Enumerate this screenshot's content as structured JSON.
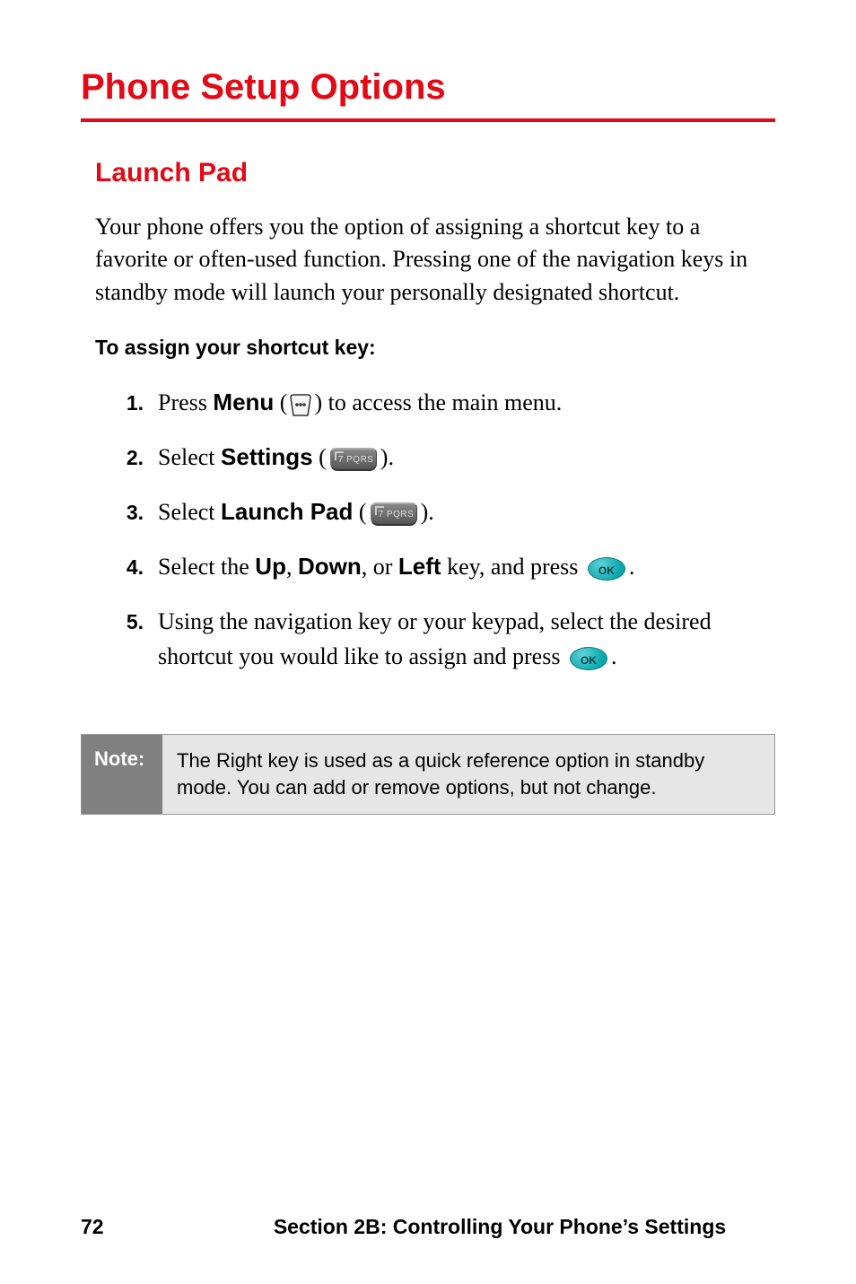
{
  "page": {
    "title": "Phone Setup Options",
    "section_heading": "Launch Pad",
    "intro_para": "Your phone offers you the option of assigning a shortcut key to a favorite or often-used function. Pressing one of the navigation keys in standby mode will launch your personally designated shortcut.",
    "subheading": "To assign your shortcut key:",
    "steps": [
      {
        "num": "1.",
        "pre": "Press ",
        "bold1": "Menu",
        "post1": " (",
        "icon1": "dots",
        "post2": ") to access the main menu."
      },
      {
        "num": "2.",
        "pre": "Select ",
        "bold1": "Settings",
        "post1": " (",
        "icon1": "key7",
        "post2": ")."
      },
      {
        "num": "3.",
        "pre": "Select ",
        "bold1": "Launch Pad",
        "post1": " (",
        "icon1": "key7",
        "post2": ")."
      },
      {
        "num": "4.",
        "pre": "Select the ",
        "bold1": "Up",
        "mid1": ", ",
        "bold2": "Down",
        "mid2": ", or ",
        "bold3": "Left",
        "post1": " key, and press ",
        "icon1": "ok",
        "post2": "."
      },
      {
        "num": "5.",
        "pre": "Using the navigation key or your keypad, select the desired shortcut you would like to assign and press ",
        "icon1": "ok",
        "post2": "."
      }
    ],
    "note_label": "Note:",
    "note_text": "The Right key is used as a quick reference option in standby mode. You can add or remove options, but not change.",
    "footer": {
      "page_number": "72",
      "section_title": "Section 2B: Controlling Your Phone’s Settings"
    },
    "icons": {
      "key7_label": "7 PQRS",
      "ok_label": "OK"
    }
  }
}
